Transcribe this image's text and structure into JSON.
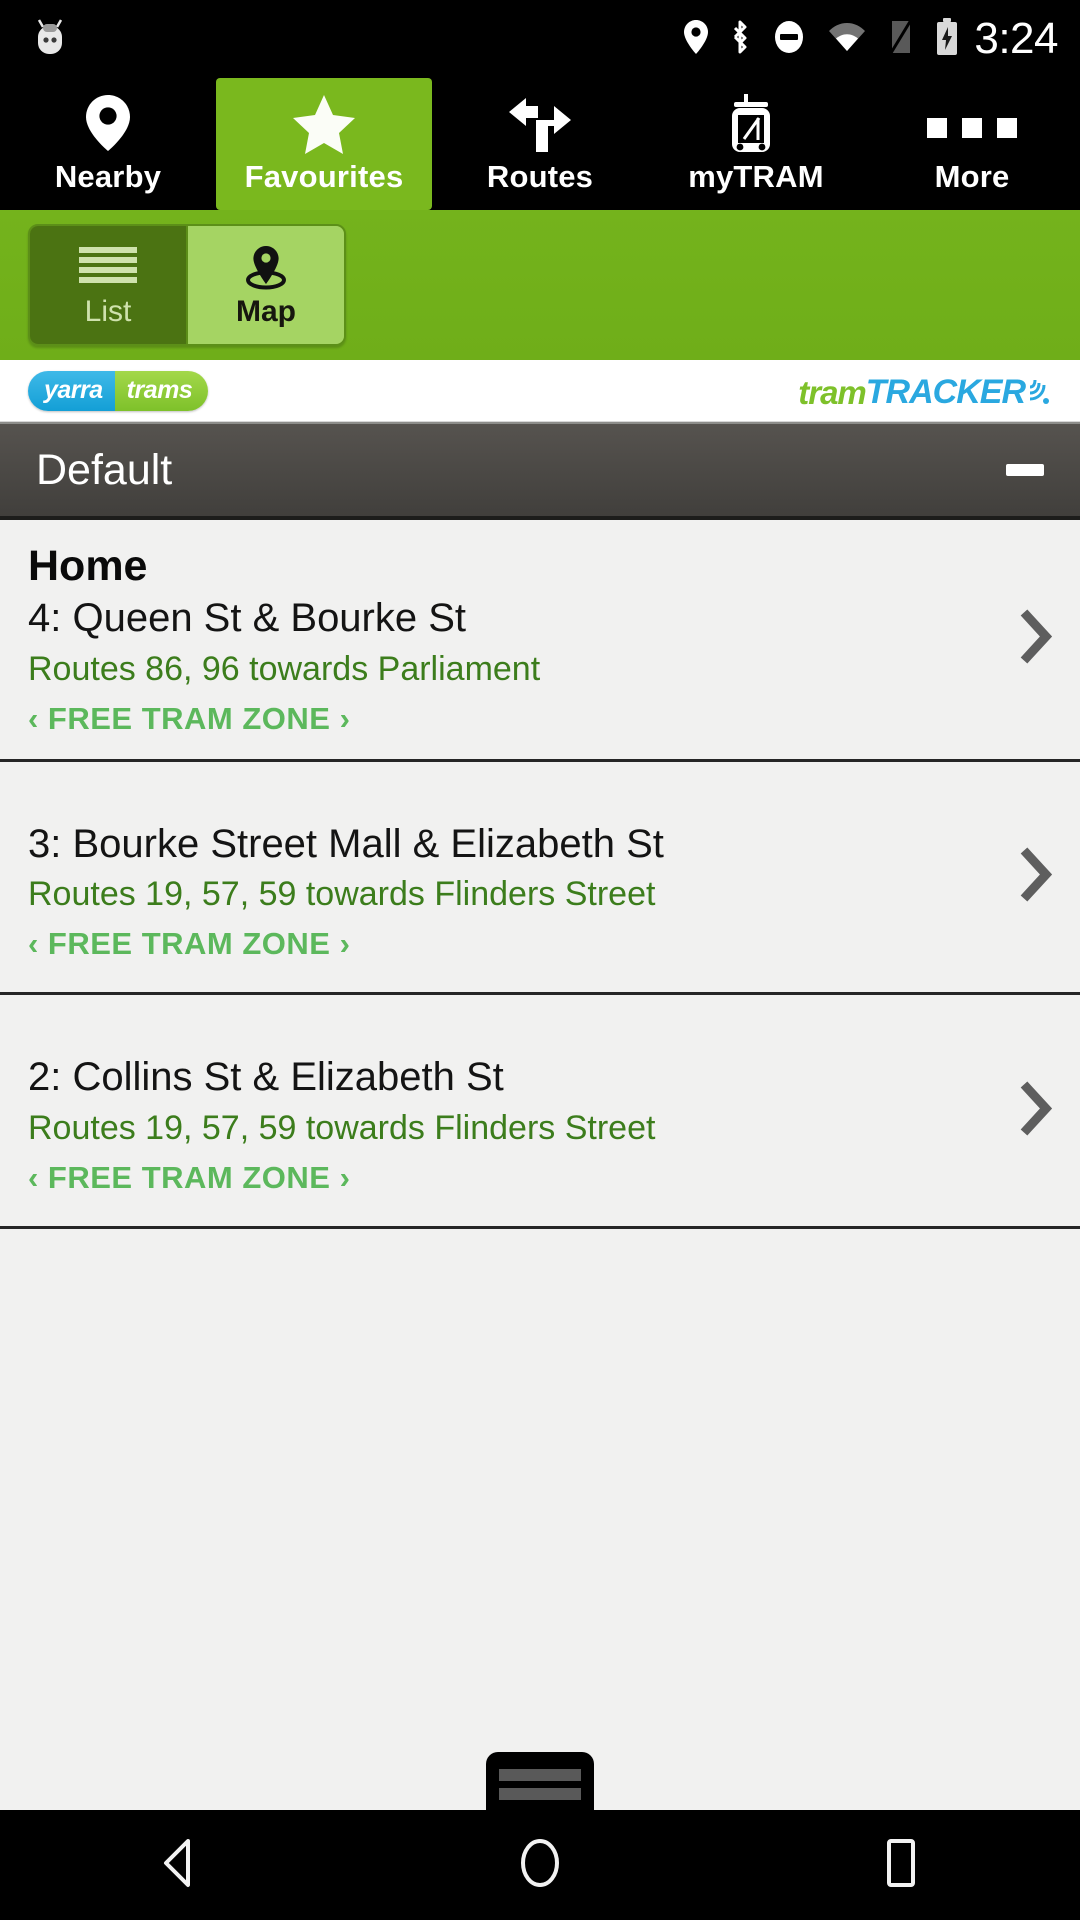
{
  "status_bar": {
    "time": "3:24",
    "icons": [
      "android-robot-icon",
      "location-pin-icon",
      "bluetooth-icon",
      "do-not-disturb-icon",
      "wifi-icon",
      "sim-card-icon",
      "battery-charging-icon"
    ]
  },
  "tabs": [
    {
      "label": "Nearby",
      "icon": "map-pin-icon",
      "active": false
    },
    {
      "label": "Favourites",
      "icon": "star-icon",
      "active": true
    },
    {
      "label": "Routes",
      "icon": "route-fork-icon",
      "active": false
    },
    {
      "label": "myTRAM",
      "icon": "tram-icon",
      "active": false
    },
    {
      "label": "More",
      "icon": "more-squares-icon",
      "active": false
    }
  ],
  "view_toggle": {
    "list_label": "List",
    "map_label": "Map",
    "selected": "List"
  },
  "branding": {
    "yarra_left": "yarra",
    "yarra_right": "trams",
    "tramtracker_prefix": "tram",
    "tramtracker_suffix": "TRACKER"
  },
  "group": {
    "title": "Default",
    "collapse_icon": "minus-icon"
  },
  "favourites": [
    {
      "name": "Home",
      "stop": "4: Queen St & Bourke St",
      "routes": "Routes 86, 96 towards Parliament",
      "zone": "‹ FREE TRAM ZONE ›"
    },
    {
      "name": "",
      "stop": "3: Bourke Street Mall & Elizabeth St",
      "routes": "Routes 19, 57, 59 towards Flinders Street",
      "zone": "‹ FREE TRAM ZONE ›"
    },
    {
      "name": "",
      "stop": "2: Collins St & Elizabeth St",
      "routes": "Routes 19, 57, 59 towards Flinders Street",
      "zone": "‹ FREE TRAM ZONE ›"
    }
  ],
  "nav_bar": {
    "back": "back-triangle-icon",
    "home": "home-circle-icon",
    "recents": "recents-square-icon"
  },
  "colors": {
    "brand_green": "#7ab81e",
    "toolbar_green": "#6fae19",
    "routes_text": "#3c7d1c",
    "free_zone_text": "#5cb85c",
    "header_gray": "#413f3c",
    "list_bg": "#f1f1f0"
  }
}
